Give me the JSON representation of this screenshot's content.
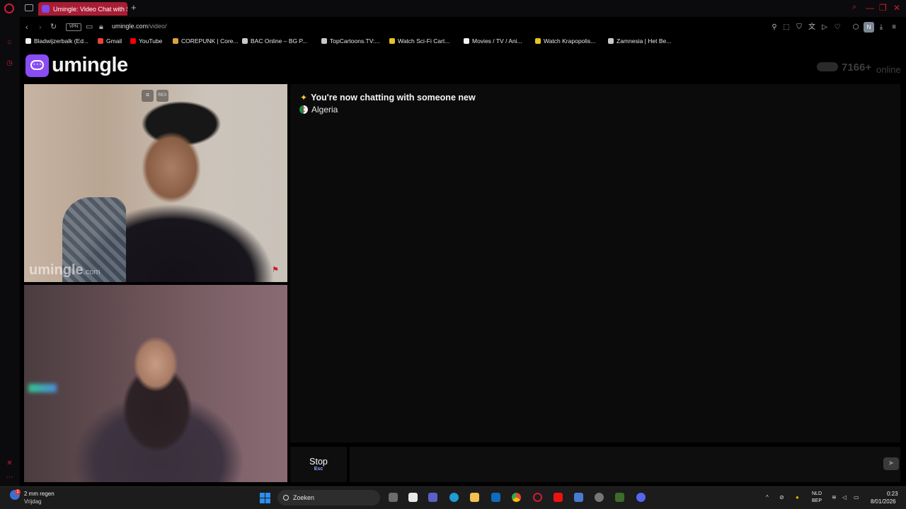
{
  "browser": {
    "tab_title": "Umingle: Video Chat with S",
    "new_tab": "+",
    "window_controls": [
      "—",
      "❐",
      "✕"
    ],
    "vpn_label": "VPN",
    "url_host": "umingle.com",
    "url_path": "/video/",
    "profile_initial": "N",
    "accent_color": "#d21a35"
  },
  "bookmarks": [
    {
      "label": "Bladwijzerbalk (Ed...",
      "icon": "folder-icon",
      "color": "#f2f2f2"
    },
    {
      "label": "Gmail",
      "icon": "gmail-icon",
      "color": "#ea4335"
    },
    {
      "label": "YouTube",
      "icon": "youtube-icon",
      "color": "#ff0000"
    },
    {
      "label": "COREPUNK | Core...",
      "icon": "corepunk-icon",
      "color": "#d9a441"
    },
    {
      "label": "BAC Online – BG P...",
      "icon": "bac-icon",
      "color": "#c9c9c9"
    },
    {
      "label": "TopCartoons.TV:...",
      "icon": "topcartoons-icon",
      "color": "#c9c9c9"
    },
    {
      "label": "Watch Sci-Fi Cart...",
      "icon": "scifi-icon",
      "color": "#e6c229"
    },
    {
      "label": "Movies / TV / Ani...",
      "icon": "play-icon",
      "color": "#f2f2f2"
    },
    {
      "label": "Watch Krapopolis...",
      "icon": "krapopolis-icon",
      "color": "#e6c229"
    },
    {
      "label": "Zamnesia | Het Be...",
      "icon": "zamnesia-icon",
      "color": "#c9c9c9"
    }
  ],
  "site": {
    "logo_text": "umingle",
    "brand_color": "#8a4cf5",
    "online_count": "7166+",
    "online_label": "online"
  },
  "video": {
    "remote_watermark": "umingle",
    "remote_watermark_suffix": ".com",
    "remote_btn_label": "REX"
  },
  "chat": {
    "status_message": "You're now chatting with someone new",
    "country": "Algeria",
    "stop_label": "Stop",
    "stop_key": "Esc"
  },
  "taskbar": {
    "weather_badge": "1",
    "weather_line1": "2 mm regen",
    "weather_line2": "Vrijdag",
    "search_placeholder": "Zoeken",
    "lang_line1": "NLD",
    "lang_line2": "BEP",
    "time": "0:23",
    "date": "8/01/2026"
  }
}
